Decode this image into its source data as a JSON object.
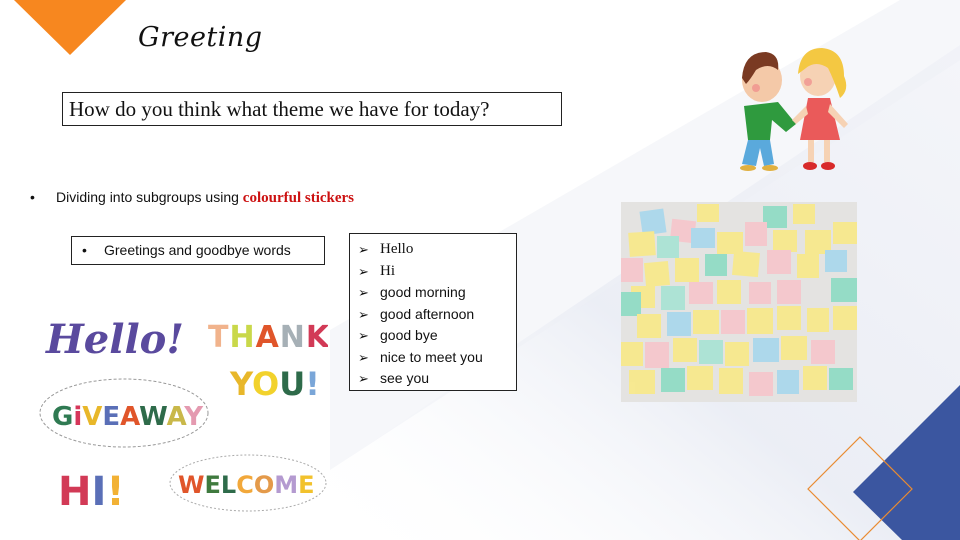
{
  "slide": {
    "title": "Greeting",
    "question": "How do you think what theme we have for today?",
    "activity": {
      "bullet": "•",
      "text": "Dividing into subgroups using ",
      "highlight": "colourful stickers"
    },
    "topic_box": {
      "bullet": "•",
      "text": "Greetings and goodbye words"
    },
    "word_list": {
      "marker": "➢",
      "items": [
        "Hello",
        "Hi",
        "good morning",
        "good afternoon",
        "good bye",
        "nice to meet you",
        "see you"
      ]
    },
    "images": {
      "stickers_art": {
        "description": "colorful lettering stickers",
        "words": [
          "Hello!",
          "THANK YOU!",
          "GIVEAWAY",
          "HI!",
          "WELCOME"
        ]
      },
      "kids_art": {
        "description": "cartoon boy and girl shaking hands"
      },
      "notes_photo": {
        "description": "wall of pastel sticky notes"
      }
    }
  },
  "colors": {
    "accent_orange": "#f7871f",
    "accent_blue": "#3b56a0",
    "highlight_red": "#cc1111",
    "band": "#eef0f6"
  }
}
